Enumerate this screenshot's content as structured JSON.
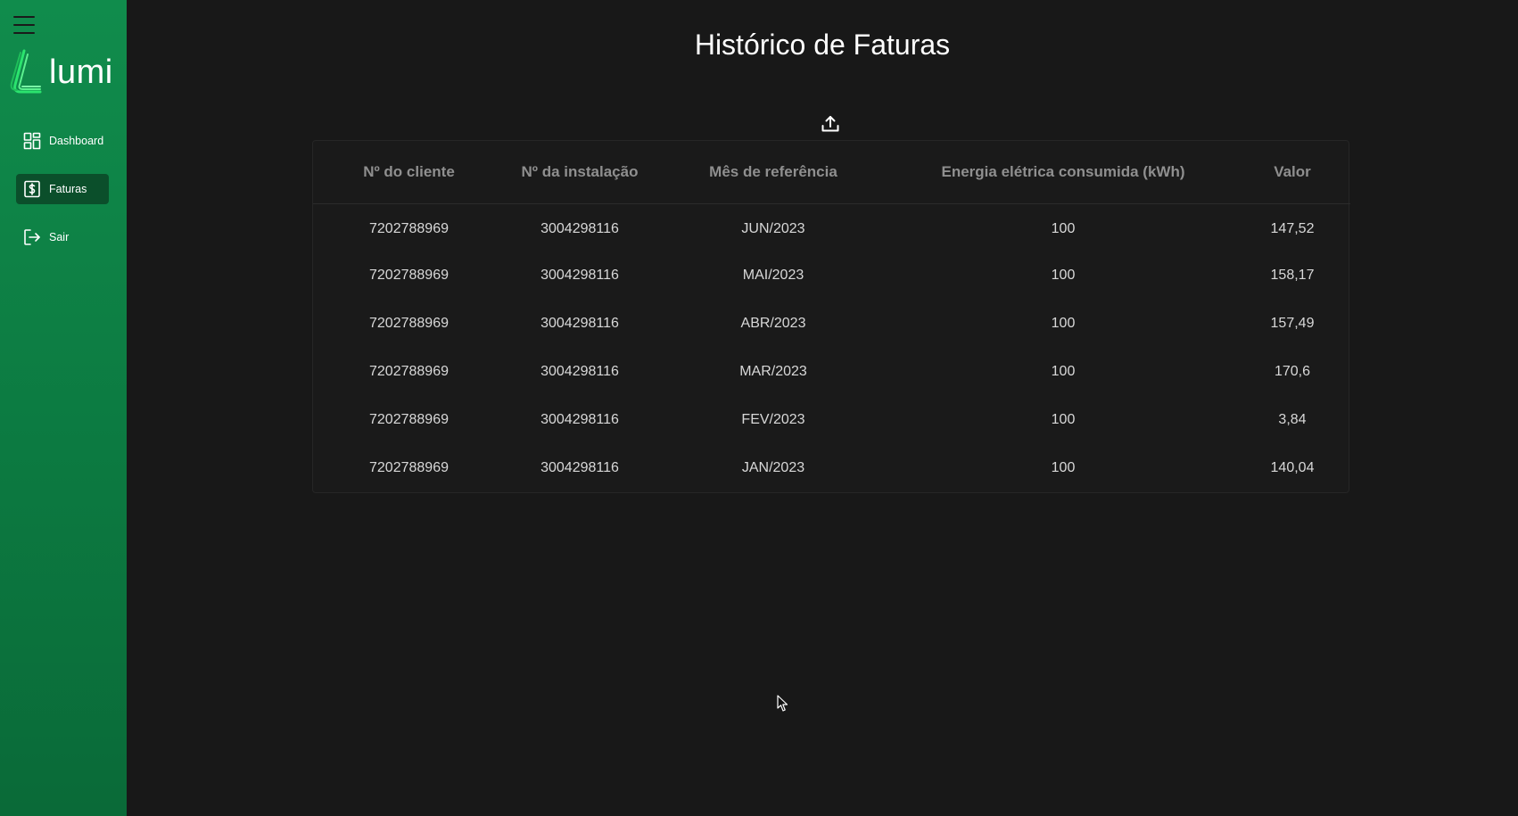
{
  "sidebar": {
    "logo_text": "lumi",
    "items": [
      {
        "label": "Dashboard",
        "icon": "dashboard-grid-icon",
        "active": false
      },
      {
        "label": "Faturas",
        "icon": "invoice-dollar-icon",
        "active": true
      },
      {
        "label": "Sair",
        "icon": "logout-icon",
        "active": false
      }
    ]
  },
  "main": {
    "title": "Histórico de Faturas",
    "upload_icon": "upload-icon",
    "table": {
      "headers": [
        "Nº do cliente",
        "Nº da instalação",
        "Mês de referência",
        "Energia elétrica consumida (kWh)",
        "Valor"
      ],
      "rows": [
        [
          "7202788969",
          "3004298116",
          "JUN/2023",
          "100",
          "147,52"
        ],
        [
          "7202788969",
          "3004298116",
          "MAI/2023",
          "100",
          "158,17"
        ],
        [
          "7202788969",
          "3004298116",
          "ABR/2023",
          "100",
          "157,49"
        ],
        [
          "7202788969",
          "3004298116",
          "MAR/2023",
          "100",
          "170,6"
        ],
        [
          "7202788969",
          "3004298116",
          "FEV/2023",
          "100",
          "3,84"
        ],
        [
          "7202788969",
          "3004298116",
          "JAN/2023",
          "100",
          "140,04"
        ]
      ]
    }
  },
  "colors": {
    "sidebar_green": "#108c4c",
    "active_item_bg": "#0b4f2b",
    "background": "#181818",
    "logo_accent": "#2be36e"
  }
}
